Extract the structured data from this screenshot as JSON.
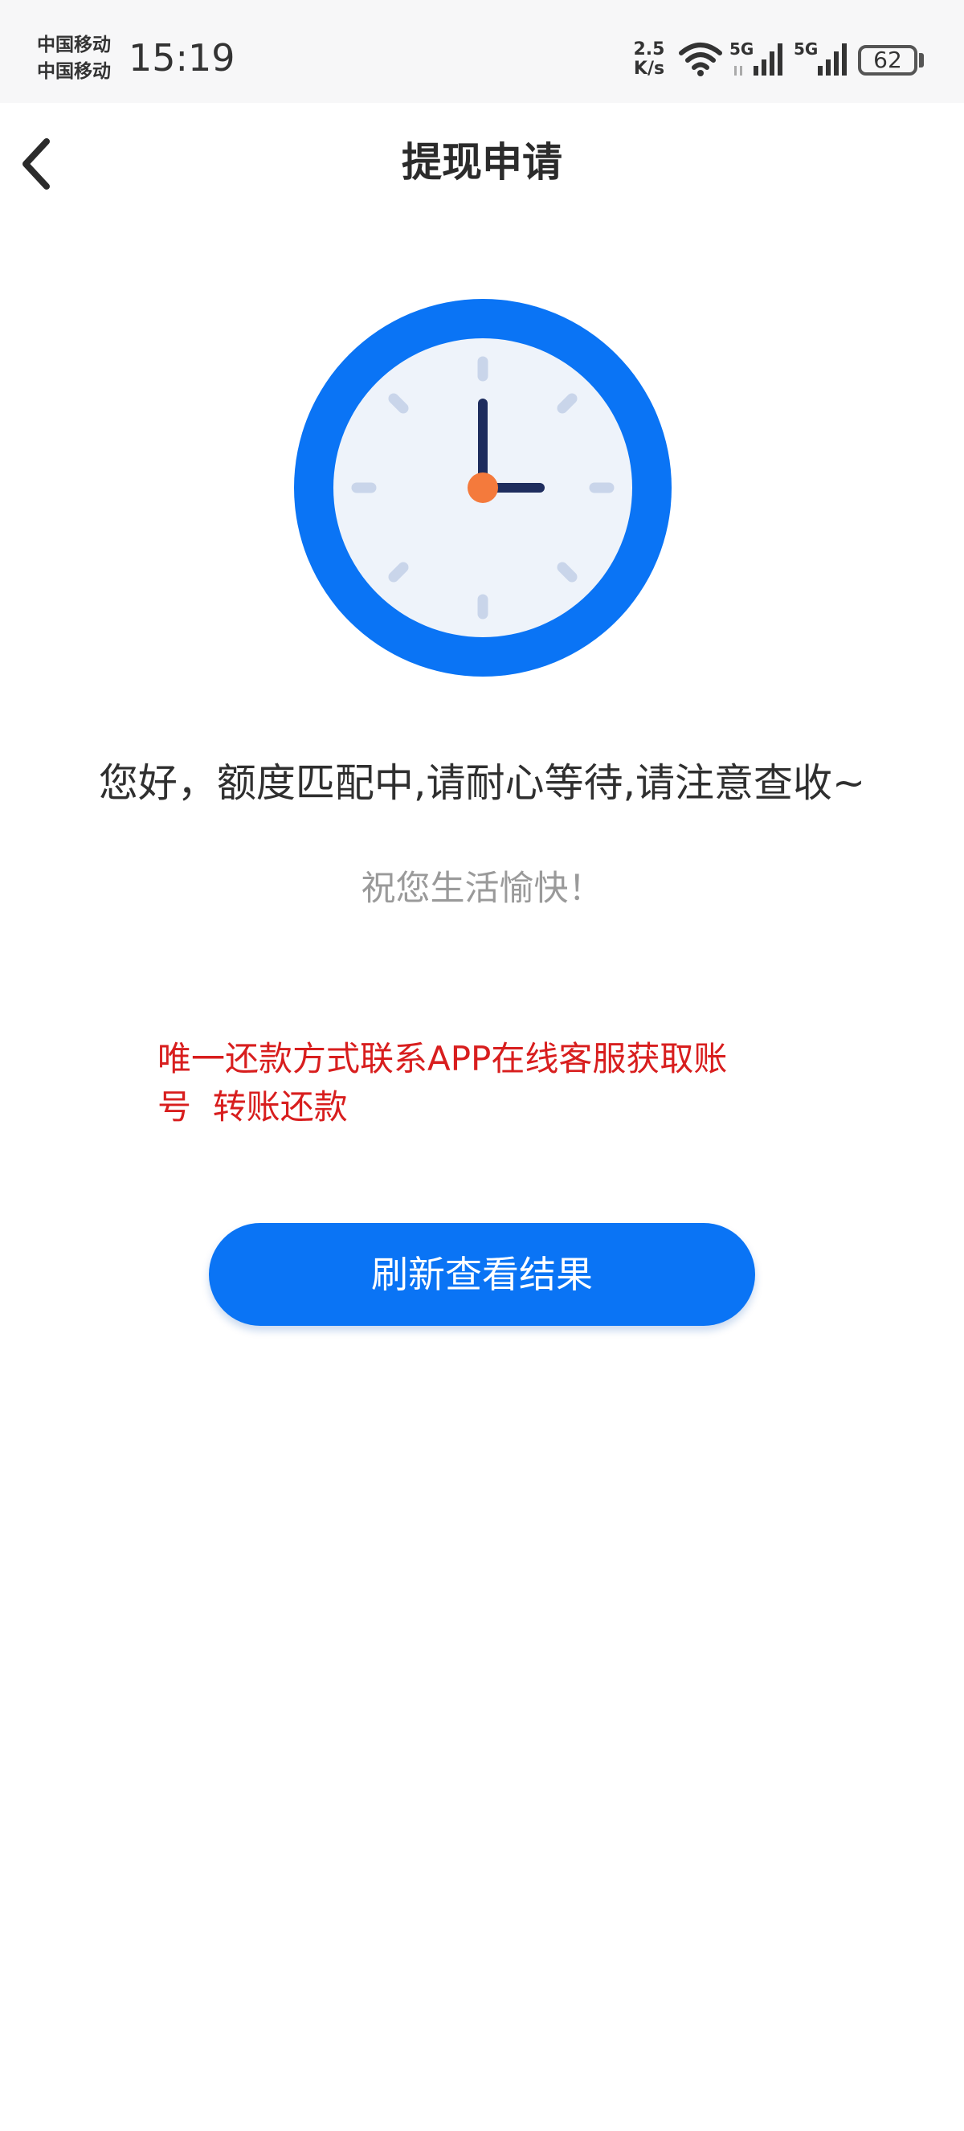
{
  "status_bar": {
    "carrier_1": "中国移动",
    "carrier_2": "中国移动",
    "time": "15:19",
    "net_speed_value": "2.5",
    "net_speed_unit": "K/s",
    "signal_1_label": "5G",
    "signal_2_label": "5G",
    "battery": "62",
    "icons": [
      "wifi-icon",
      "signal-5g-icon",
      "signal-5g-icon",
      "battery-icon"
    ]
  },
  "nav": {
    "title": "提现申请",
    "back_icon": "chevron-left-icon"
  },
  "illustration": {
    "icon": "clock-icon",
    "colors": {
      "ring": "#0a74f5",
      "face": "#eef3fa",
      "ticks": "#c9d5ea",
      "hands": "#1e2d5e",
      "center": "#f47a3c"
    }
  },
  "content": {
    "message": "您好，额度匹配中,请耐心等待,请注意查收~",
    "wish": "祝您生活愉快！",
    "notice_line_1": "唯一还款方式联系APP在线客服获取账",
    "notice_line_2": "号  转账还款",
    "notice_color": "#d81e1e"
  },
  "actions": {
    "refresh_label": "刷新查看结果",
    "button_color": "#0a74f5"
  }
}
